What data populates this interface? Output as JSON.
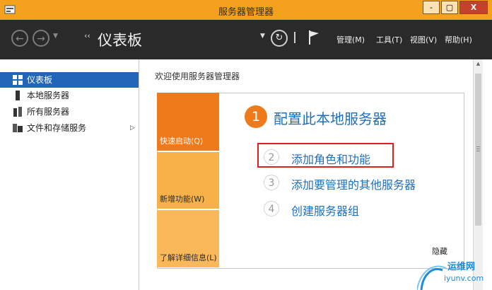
{
  "window": {
    "title": "服务器管理器",
    "controls": [
      "-",
      "▢",
      "X"
    ]
  },
  "toolbar": {
    "breadcrumb_arrow": "‹‹",
    "page_title": "仪表板",
    "refresh_icon": "refresh-icon",
    "flag_icon": "notifications-flag-icon",
    "menus": [
      "管理(M)",
      "工具(T)",
      "视图(V)",
      "帮助(H)"
    ]
  },
  "sidebar": {
    "items": [
      {
        "label": "仪表板",
        "icon": "dashboard-icon",
        "active": true
      },
      {
        "label": "本地服务器",
        "icon": "server-icon",
        "active": false
      },
      {
        "label": "所有服务器",
        "icon": "servers-icon",
        "active": false
      },
      {
        "label": "文件和存储服务",
        "icon": "storage-icon",
        "active": false,
        "expand": "▷"
      }
    ]
  },
  "main": {
    "welcome": "欢迎使用服务器管理器",
    "tiles": [
      "快速启动(Q)",
      "新增功能(W)",
      "了解详细信息(L)"
    ],
    "step1": {
      "num": "1",
      "label": "配置此本地服务器"
    },
    "steps": [
      {
        "num": "2",
        "label": "添加角色和功能"
      },
      {
        "num": "3",
        "label": "添加要管理的其他服务器"
      },
      {
        "num": "4",
        "label": "创建服务器组"
      }
    ],
    "hide": "隐藏"
  },
  "watermark": {
    "line1": "运维网",
    "line2": "iyunv.com"
  },
  "colors": {
    "accent_orange": "#ee7a1c",
    "link_blue": "#1f6fbd",
    "titlebar": "#f4a11d",
    "selection": "#2166b8",
    "highlight_red": "#d9221c"
  }
}
